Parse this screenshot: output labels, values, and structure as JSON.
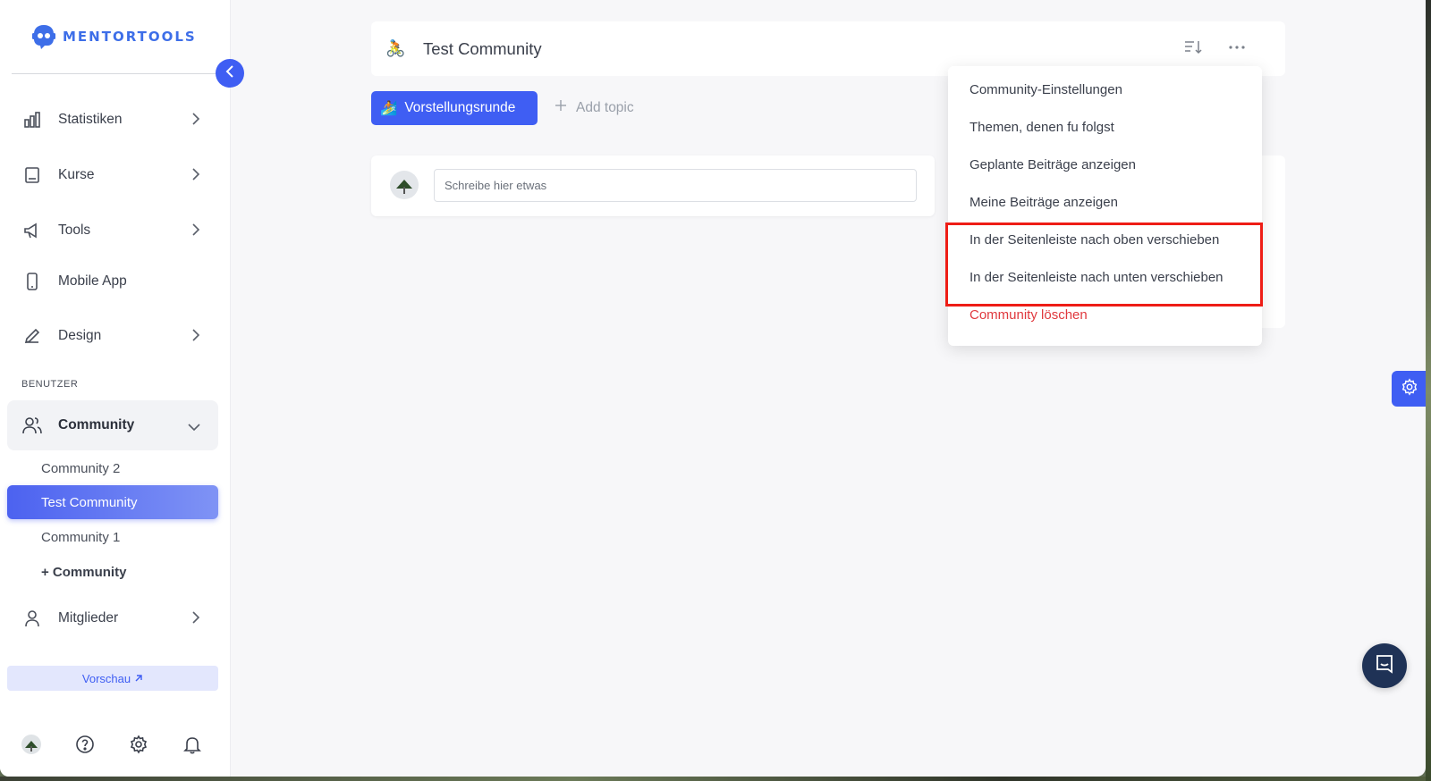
{
  "app": {
    "logo_text": "MENTORTOOLS"
  },
  "sidebar": {
    "items": [
      {
        "label": "Statistiken",
        "icon": "bar-chart-icon"
      },
      {
        "label": "Kurse",
        "icon": "book-icon"
      },
      {
        "label": "Tools",
        "icon": "megaphone-icon"
      },
      {
        "label": "Mobile App",
        "icon": "smartphone-icon"
      },
      {
        "label": "Design",
        "icon": "pencil-icon"
      }
    ],
    "section_label": "BENUTZER",
    "community_group": {
      "label": "Community",
      "icon": "users-icon",
      "sub_items": [
        "Community 2",
        "Test Community",
        "Community 1",
        "+ Community"
      ],
      "selected": "Test Community"
    },
    "members": {
      "label": "Mitglieder",
      "icon": "user-icon"
    },
    "preview_label": "Vorschau",
    "bottom_icons": [
      "avatar",
      "help-icon",
      "gear-icon",
      "bell-icon"
    ]
  },
  "header": {
    "emoji": "🚴",
    "title": "Test Community"
  },
  "topics": {
    "active_emoji": "🏄",
    "active_label": "Vorstellungsrunde",
    "add_label": "Add topic"
  },
  "composer": {
    "placeholder": "Schreibe hier etwas"
  },
  "menu": {
    "items": [
      "Community-Einstellungen",
      "Themen, denen fu folgst",
      "Geplante Beiträge anzeigen",
      "Meine Beiträge anzeigen",
      "In der Seitenleiste nach oben verschieben",
      "In der Seitenleiste nach unten verschieben"
    ],
    "danger_item": "Community löschen"
  },
  "colors": {
    "accent": "#3f5ef3",
    "danger": "#e0393e",
    "highlight": "#ee1d16",
    "chat": "#1f3256"
  }
}
